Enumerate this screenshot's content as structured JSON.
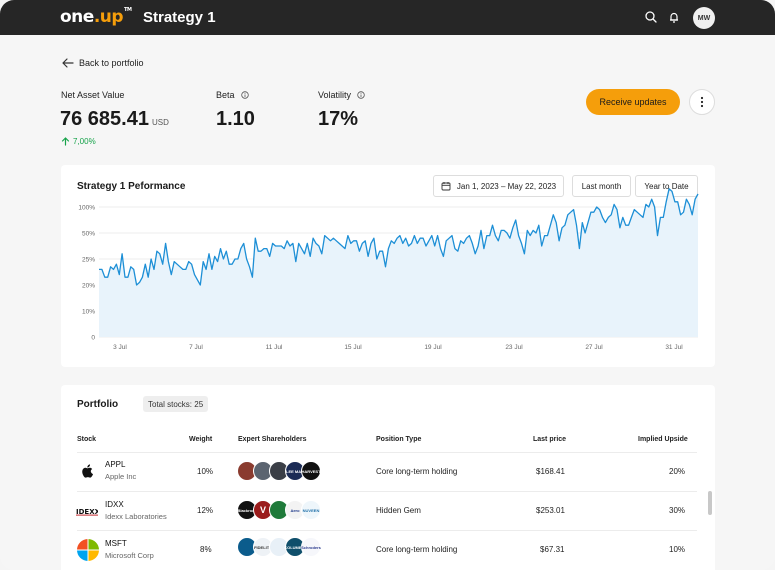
{
  "header": {
    "logo_text": "one",
    "logo_dot": ".up",
    "logo_tm": "TM",
    "title": "Strategy 1",
    "avatar_initials": "MW"
  },
  "nav": {
    "back_label": "Back to portfolio"
  },
  "stats": {
    "nav_label": "Net Asset Value",
    "nav_value": "76 685.41",
    "nav_unit": "USD",
    "nav_change": "7,00%",
    "beta_label": "Beta",
    "beta_value": "1.10",
    "volatility_label": "Volatility",
    "volatility_value": "17%"
  },
  "actions": {
    "receive_updates": "Receive updates"
  },
  "performance": {
    "title": "Strategy 1 Peformance",
    "date_range": "Jan 1, 2023 – May 22, 2023",
    "last_month": "Last month",
    "year_to_date": "Year to Date"
  },
  "chart_data": {
    "type": "area",
    "title": "Strategy 1 Peformance",
    "y_ticks": [
      "100%",
      "50%",
      "25%",
      "20%",
      "10%",
      "0"
    ],
    "x_ticks": [
      "3 Jul",
      "7 Jul",
      "11 Jul",
      "15 Jul",
      "19 Jul",
      "23 Jul",
      "27 Jul",
      "31 Jul"
    ],
    "color": "#1d8fd6",
    "fill": "#e8f3fb",
    "grid": true,
    "values": [
      2.6,
      2.6,
      2.3,
      2.3,
      2.7,
      2.6,
      2.8,
      2.4,
      3.2,
      2.3,
      2.3,
      2.7,
      2.6,
      2.0,
      2.1,
      2.3,
      2.8,
      2.3,
      3.0,
      2.6,
      3.3,
      3.2,
      2.8,
      3.6,
      2.9,
      2.4,
      2.9,
      2.8,
      2.7,
      2.6,
      2.6,
      2.9,
      2.8,
      2.4,
      2.2,
      2.0,
      2.9,
      2.6,
      3.2,
      2.6,
      3.1,
      2.9,
      3.4,
      3.0,
      3.3,
      2.8,
      2.8,
      3.0,
      3.0,
      3.4,
      3.6,
      3.0,
      2.7,
      2.3,
      3.8,
      3.3,
      3.3,
      3.4,
      3.4,
      3.1,
      3.6,
      3.5,
      3.5,
      3.5,
      3.4,
      3.7,
      3.5,
      3.6,
      2.9,
      3.6,
      3.4,
      3.2,
      3.6,
      3.1,
      3.8,
      3.6,
      3.5,
      3.2,
      3.9,
      3.8,
      3.7,
      3.8,
      3.7,
      3.6,
      3.5,
      3.4,
      3.9,
      3.6,
      3.7,
      3.7,
      3.3,
      3.6,
      3.7,
      3.1,
      3.6,
      3.8,
      3.0,
      3.3,
      3.3,
      2.7,
      3.4,
      3.7,
      3.6,
      3.8,
      3.9,
      3.6,
      3.8,
      3.5,
      3.6,
      3.9,
      3.6,
      3.8,
      3.8,
      3.5,
      3.7,
      3.9,
      3.5,
      3.9,
      3.4,
      3.1,
      3.7,
      3.8,
      3.9,
      3.4,
      3.3,
      3.7,
      3.6,
      3.8,
      3.9,
      3.6,
      3.2,
      3.5,
      4.1,
      3.4,
      3.9,
      3.9,
      4.3,
      3.9,
      3.7,
      4.1,
      4.1,
      4.0,
      3.8,
      4.2,
      4.5,
      3.9,
      3.6,
      3.2,
      4.1,
      3.9,
      4.1,
      4.0,
      4.3,
      3.5,
      3.9,
      3.9,
      4.3,
      4.7,
      4.4,
      3.7,
      4.2,
      4.3,
      4.7,
      4.8,
      4.9,
      4.3,
      3.4,
      4.4,
      4.0,
      4.4,
      4.8,
      4.8,
      5.0,
      4.9,
      4.6,
      4.4,
      4.6,
      4.7,
      5.1,
      4.9,
      4.2,
      4.6,
      4.3,
      4.3,
      4.6,
      4.9,
      4.8,
      4.7,
      4.6,
      5.1,
      5.0,
      5.3,
      5.0,
      3.9,
      4.6,
      4.6,
      5.2,
      5.7,
      5.6,
      5.2,
      5.2,
      4.7,
      4.8,
      5.3,
      5.1,
      4.7,
      5.3,
      5.5
    ]
  },
  "portfolio": {
    "title": "Portfolio",
    "total_label": "Total stocks: 25",
    "columns": [
      "Stock",
      "Weight",
      "Expert Shareholders",
      "Position Type",
      "Last price",
      "Implied Upside"
    ],
    "rows": [
      {
        "ticker": "APPL",
        "company": "Apple Inc",
        "logo": "apple-logo",
        "weight": "10%",
        "position": "Core long-term holding",
        "price": "$168.41",
        "upside": "20%"
      },
      {
        "ticker": "IDXX",
        "company": "Idexx Laboratories",
        "logo": "idexx-logo",
        "weight": "12%",
        "position": "Hidden Gem",
        "price": "$253.01",
        "upside": "30%"
      },
      {
        "ticker": "MSFT",
        "company": "Microsoft Corp",
        "logo": "microsoft-logo",
        "weight": "8%",
        "position": "Core long-term holding",
        "price": "$67.31",
        "upside": "10%"
      }
    ],
    "shareholder_labels": {
      "row0_3": "LEE MAN",
      "row0_4": "HARVEST",
      "row1_0": "Blackrock",
      "row1_1": "V",
      "row1_3": "Aero",
      "row1_4": "NUVEEN",
      "row2_1": "FIDELITY",
      "row2_3": "COLUMBIA",
      "row2_4": "Schroders"
    }
  }
}
